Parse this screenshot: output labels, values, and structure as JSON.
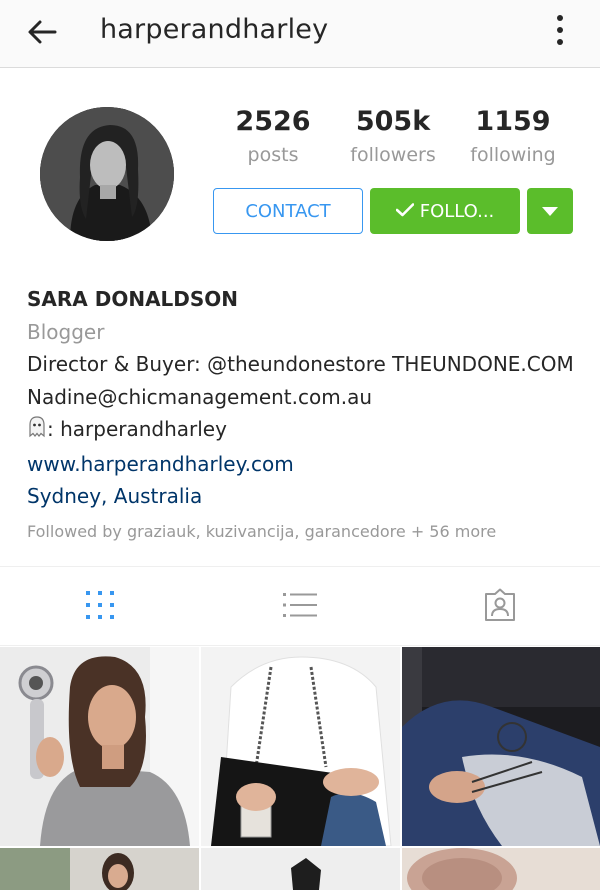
{
  "header": {
    "username": "harperandharley"
  },
  "stats": {
    "posts_count": "2526",
    "posts_label": "posts",
    "followers_count": "505k",
    "followers_label": "followers",
    "following_count": "1159",
    "following_label": "following"
  },
  "actions": {
    "contact_label": "CONTACT",
    "follow_label": "FOLLO..."
  },
  "bio": {
    "full_name": "SARA DONALDSON",
    "category": "Blogger",
    "line1": "Director & Buyer: @theundonestore THEUNDONE.COM",
    "line2": "Nadine@chicmanagement.com.au",
    "snapchat_handle": ": harperandharley",
    "website": "www.harperandharley.com",
    "location": "Sydney, Australia",
    "followed_by": "Followed by graziauk, kuzivancija, garancedore + 56 more"
  },
  "tabs": [
    "grid-view",
    "list-view",
    "tagged-photos"
  ],
  "colors": {
    "accent_blue": "#3897f0",
    "follow_green": "#5bbd2b",
    "link_blue": "#003569",
    "muted_gray": "#999999"
  },
  "photos": [
    "woman with hair dryer in grey t-shirt",
    "white t-shirt with black chain bag and perfume",
    "hand holding sunglasses in car",
    "woman outdoors",
    "black boots",
    "pink ceramic"
  ]
}
